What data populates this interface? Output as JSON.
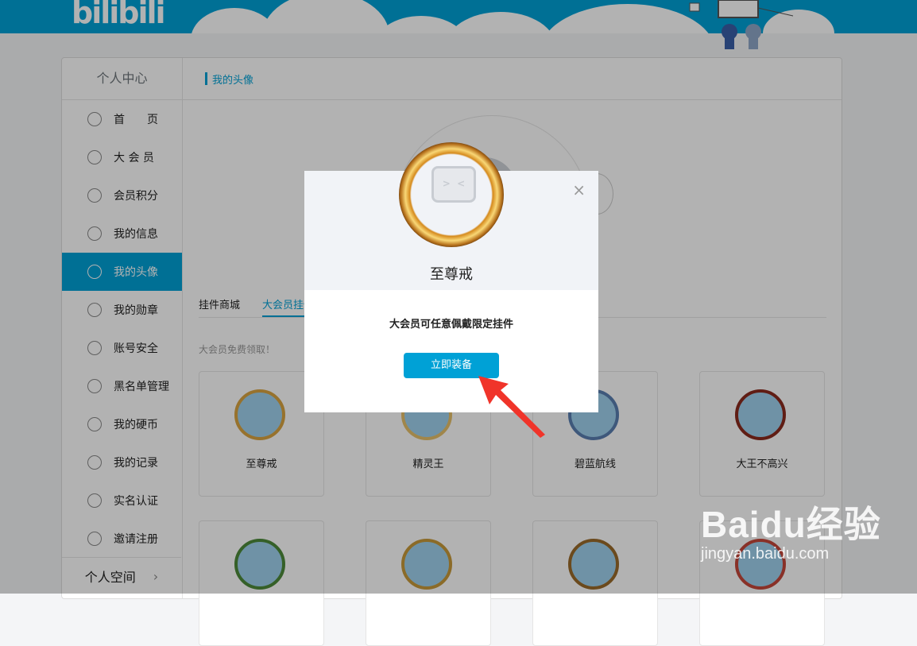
{
  "header": {
    "logo_text": "bilibili"
  },
  "sidebar": {
    "title": "个人中心",
    "items": [
      {
        "label": "首　　页",
        "icon": "home-icon"
      },
      {
        "label": "大 会 员",
        "icon": "vip-icon"
      },
      {
        "label": "会员积分",
        "icon": "points-icon"
      },
      {
        "label": "我的信息",
        "icon": "user-icon"
      },
      {
        "label": "我的头像",
        "icon": "avatar-icon",
        "active": true
      },
      {
        "label": "我的勋章",
        "icon": "medal-icon"
      },
      {
        "label": "账号安全",
        "icon": "shield-icon"
      },
      {
        "label": "黑名单管理",
        "icon": "blacklist-icon"
      },
      {
        "label": "我的硬币",
        "icon": "coin-icon"
      },
      {
        "label": "我的记录",
        "icon": "record-icon"
      },
      {
        "label": "实名认证",
        "icon": "id-card-icon"
      },
      {
        "label": "邀请注册",
        "icon": "invite-icon"
      }
    ],
    "footer": "个人空间",
    "footer_chevron": "›"
  },
  "content": {
    "section_title": "我的头像",
    "tabs": [
      "挂件商城",
      "大会员挂件"
    ],
    "hint": "大会员免费领取！",
    "cards": [
      "至尊戒",
      "精灵王",
      "碧蓝航线",
      "大王不高兴"
    ]
  },
  "modal": {
    "title": "至尊戒",
    "description": "大会员可任意佩戴限定挂件",
    "button_label": "立即装备",
    "close": "×"
  },
  "watermark": {
    "line1": "Baidu经验",
    "line2": "jingyan.baidu.com"
  },
  "colors": {
    "accent": "#00a1d6",
    "overlay": "rgba(0,0,0,0.3)",
    "arrow": "#f0342a"
  }
}
